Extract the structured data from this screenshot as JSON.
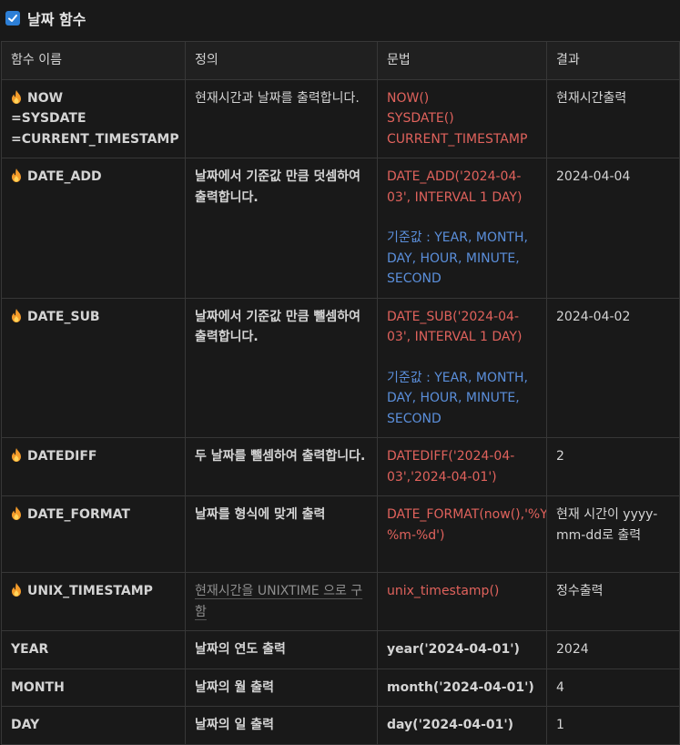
{
  "title": "날짜 함수",
  "headers": [
    "함수 이름",
    "정의",
    "문법",
    "결과"
  ],
  "rows": [
    {
      "name_lines": [
        "NOW",
        "=SYSDATE",
        "=CURRENT_TIMESTAMP"
      ],
      "definition": "현재시간과 날짜를 출력합니다.",
      "syntax_red": [
        "NOW()",
        "SYSDATE()",
        "CURRENT_TIMESTAMP"
      ],
      "result": "현재시간출력"
    },
    {
      "name_lines": [
        "DATE_ADD"
      ],
      "definition": "날짜에서 기준값 만큼 덧셈하여 출력합니다.",
      "syntax_red": [
        "DATE_ADD('2024-04-03', INTERVAL 1 DAY)"
      ],
      "syntax_blue": "기준값 : YEAR, MONTH, DAY, HOUR, MINUTE, SECOND",
      "result": "2024-04-04"
    },
    {
      "name_lines": [
        "DATE_SUB"
      ],
      "definition": "날짜에서 기준값 만큼 뺄셈하여 출력합니다.",
      "syntax_red": [
        "DATE_SUB('2024-04-03', INTERVAL 1 DAY)"
      ],
      "syntax_blue": "기준값 : YEAR, MONTH, DAY, HOUR, MINUTE, SECOND",
      "result": "2024-04-02"
    },
    {
      "name_lines": [
        "DATEDIFF"
      ],
      "definition": "두 날짜를 뺄셈하여 출력합니다.",
      "syntax_red": [
        "DATEDIFF('2024-04-03','2024-04-01')"
      ],
      "result": "2"
    },
    {
      "name_lines": [
        "DATE_FORMAT"
      ],
      "definition": "날짜를 형식에 맞게 출력",
      "syntax_red": [
        "DATE_FORMAT(now(),'%Y-%m-%d')"
      ],
      "result": "현재 시간이 yyyy-mm-dd로 출력"
    },
    {
      "name_lines": [
        "UNIX_TIMESTAMP"
      ],
      "definition": "현재시간을 UNIXTIME 으로 구함",
      "syntax_red": [
        "unix_timestamp()"
      ],
      "result": "정수출력"
    },
    {
      "name_lines": [
        "YEAR"
      ],
      "definition": "날짜의 연도 출력",
      "syntax_plain": "year('2024-04-01')",
      "result": "2024"
    },
    {
      "name_lines": [
        "MONTH"
      ],
      "definition": "날짜의 월 출력",
      "syntax_plain": "month('2024-04-01')",
      "result": "4"
    },
    {
      "name_lines": [
        "DAY"
      ],
      "definition": "날짜의 일 출력",
      "syntax_plain": "day('2024-04-01')",
      "result": "1"
    }
  ],
  "colors": {
    "accent": "#2d7fd6",
    "syntax": "#e0625c",
    "note": "#5b8fdb",
    "background": "#191919"
  }
}
